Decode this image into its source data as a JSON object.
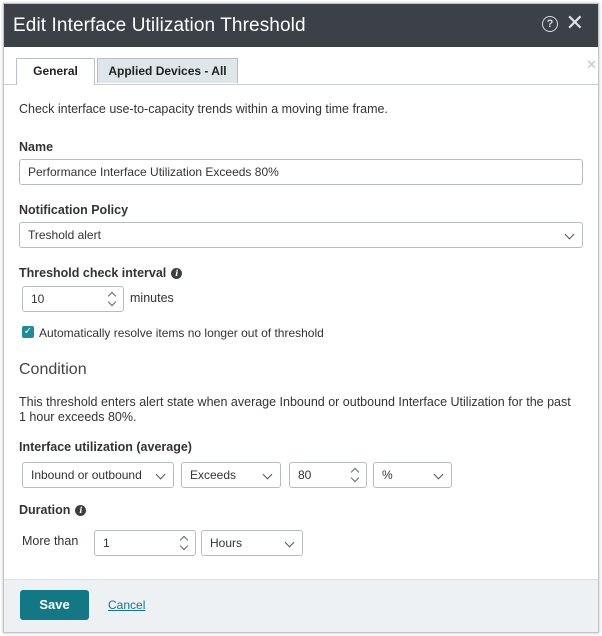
{
  "dialog": {
    "title": "Edit Interface Utilization Threshold",
    "icons": {
      "help": "question-circle-icon",
      "close": "close-icon"
    }
  },
  "tabs": [
    {
      "label": "General",
      "active": true
    },
    {
      "label": "Applied Devices - All",
      "active": false
    }
  ],
  "general": {
    "description": "Check interface use-to-capacity trends within a moving time frame.",
    "name_label": "Name",
    "name_value": "Performance Interface Utilization Exceeds 80%",
    "policy_label": "Notification Policy",
    "policy_value": "Treshold alert",
    "interval_label": "Threshold check interval",
    "interval_value": "10",
    "interval_unit": "minutes",
    "auto_resolve_label": "Automatically resolve items no longer out of threshold",
    "auto_resolve_checked": true
  },
  "condition": {
    "heading": "Condition",
    "text": "This threshold enters alert state when average Inbound or outbound Interface Utilization for the past 1 hour exceeds 80%.",
    "utilization_label": "Interface utilization (average)",
    "direction_value": "Inbound or outbound",
    "operator_value": "Exceeds",
    "threshold_value": "80",
    "unit_value": "%",
    "duration_label": "Duration",
    "more_than_label": "More than",
    "duration_value": "1",
    "duration_unit_value": "Hours"
  },
  "footer": {
    "save_label": "Save",
    "cancel_label": "Cancel"
  },
  "colors": {
    "titlebar": "#3c4147",
    "accent": "#137886",
    "checkbox": "#1e8a9a",
    "inactive_tab": "#dfe6ea",
    "footer": "#eef1f3"
  }
}
